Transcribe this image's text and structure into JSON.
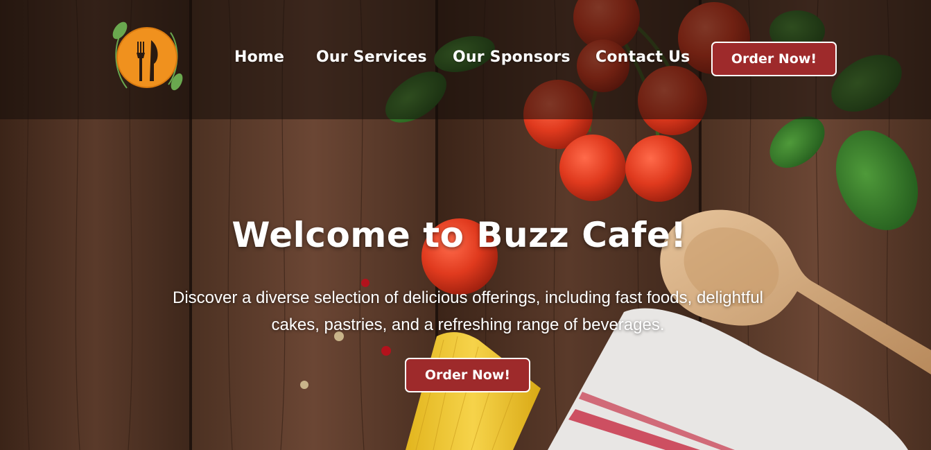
{
  "colors": {
    "header_overlay": "#140c0a",
    "button_bg": "#9e2a2b",
    "button_border": "#ffffff",
    "logo_orange": "#f0911e",
    "logo_green": "#6aa84f",
    "text": "#ffffff"
  },
  "logo": {
    "icon": "fork-knife-plate-icon"
  },
  "nav": {
    "items": [
      {
        "label": "Home"
      },
      {
        "label": "Our Services"
      },
      {
        "label": "Our Sponsors"
      },
      {
        "label": "Contact Us"
      }
    ],
    "cta_label": "Order Now!"
  },
  "hero": {
    "title": "Welcome to Buzz Cafe!",
    "description": "Discover a diverse selection of delicious offerings, including fast foods, delightful cakes, pastries, and a refreshing range of beverages.",
    "cta_label": "Order Now!"
  }
}
